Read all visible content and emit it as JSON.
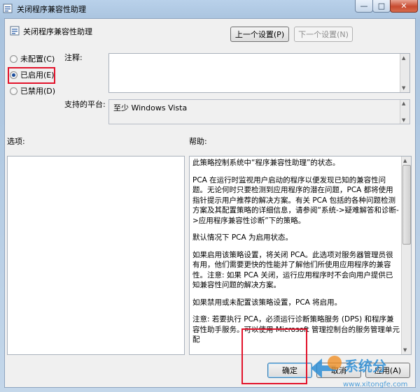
{
  "window": {
    "title": "关闭程序兼容性助理",
    "close_glyph": "✕",
    "minimize_glyph": "—",
    "maximize_glyph": "□"
  },
  "header": {
    "title": "关闭程序兼容性助理",
    "prev_button": "上一个设置(P)",
    "next_button": "下一个设置(N)"
  },
  "state": {
    "options": [
      {
        "label": "未配置(C)",
        "selected": false
      },
      {
        "label": "已启用(E)",
        "selected": true
      },
      {
        "label": "已禁用(D)",
        "selected": false
      }
    ]
  },
  "comment": {
    "label": "注释:",
    "value": ""
  },
  "platform": {
    "label": "支持的平台:",
    "value": "至少 Windows Vista"
  },
  "panes": {
    "options_label": "选项:",
    "help_label": "帮助:",
    "help_paragraphs": [
      "此策略控制系统中“程序兼容性助理”的状态。",
      "PCA 在运行时监视用户启动的程序以便发现已知的兼容性问题。无论何时只要检测到应用程序的潜在问题，PCA 都将使用指针提示用户推荐的解决方案。有关 PCA 包括的各种问题检测方案及其配置策略的详细信息，请参阅“系统->疑难解答和诊断->应用程序兼容性诊断”下的策略。",
      "默认情况下 PCA 为启用状态。",
      "如果启用该策略设置，将关闭 PCA。此选项对服务器管理员很有用，他们需要更快的性能并了解他们所使用应用程序的兼容性。注意: 如果 PCA 关闭，运行应用程序时不会向用户提供已知兼容性问题的解决方案。",
      "如果禁用或未配置该策略设置，PCA 将启用。",
      "注意: 若要执行 PCA，必须运行诊断策略服务 (DPS) 和程序兼容性助手服务。可以使用 Microsoft 管理控制台的服务管理单元配"
    ]
  },
  "footer": {
    "ok_button": "确定",
    "cancel_button": "取消",
    "apply_button": "应用(A)"
  },
  "watermark": {
    "brand": "系统分",
    "url": "www.xitongfe.com"
  },
  "colors": {
    "highlight": "#e2132b",
    "close_button": "#c74a2f"
  }
}
